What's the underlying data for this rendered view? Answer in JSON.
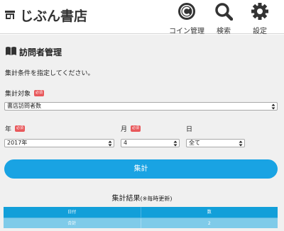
{
  "app": {
    "title": "じぶん書店"
  },
  "header": {
    "coin_label": "コイン管理",
    "search_label": "検索",
    "settings_label": "設定"
  },
  "section": {
    "title": "訪問者管理",
    "instruction": "集計条件を指定してください。"
  },
  "form": {
    "target_label": "集計対象",
    "required_badge": "必須",
    "target_value": "書店訪問者数",
    "year_label": "年",
    "month_label": "月",
    "day_label": "日",
    "year_value": "2017年",
    "month_value": "4",
    "day_value": "全て",
    "submit_label": "集計"
  },
  "result": {
    "title": "集計結果",
    "note": "(※毎時更新)",
    "columns": [
      "日付",
      "数"
    ],
    "rows": [
      [
        "合計",
        "2"
      ]
    ]
  },
  "colors": {
    "accent": "#19a3e3",
    "table_header": "#129fd9",
    "table_row": "#7fcbe9",
    "required": "#e8585b"
  }
}
